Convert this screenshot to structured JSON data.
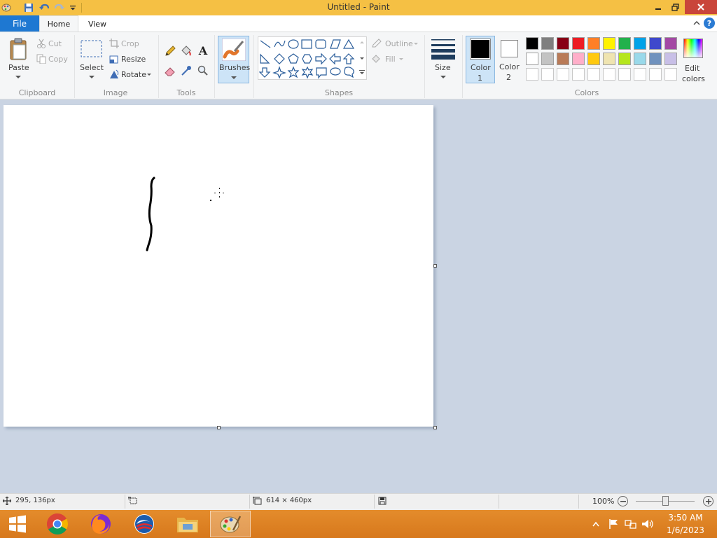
{
  "window": {
    "title": "Untitled - Paint"
  },
  "tabs": {
    "file": "File",
    "home": "Home",
    "view": "View"
  },
  "clipboard": {
    "paste": "Paste",
    "cut": "Cut",
    "copy": "Copy",
    "group": "Clipboard"
  },
  "image": {
    "select": "Select",
    "crop": "Crop",
    "resize": "Resize",
    "rotate": "Rotate",
    "group": "Image"
  },
  "tools": {
    "group": "Tools"
  },
  "brushes": {
    "label": "Brushes"
  },
  "shapes": {
    "outline": "Outline",
    "fill": "Fill",
    "group": "Shapes"
  },
  "size": {
    "label": "Size"
  },
  "colors": {
    "color1_label": "Color",
    "color1_num": "1",
    "color2_label": "Color",
    "color2_num": "2",
    "edit_label": "Edit",
    "edit_label2": "colors",
    "group": "Colors",
    "color1": "#000000",
    "color2": "#ffffff",
    "palette_row1": [
      "#000000",
      "#7f7f7f",
      "#880015",
      "#ed1c24",
      "#ff7f27",
      "#fff200",
      "#22b14c",
      "#00a2e8",
      "#3f48cc",
      "#a349a4"
    ],
    "palette_row2": [
      "#ffffff",
      "#c3c3c3",
      "#b97a57",
      "#ffaec9",
      "#ffc90e",
      "#efe4b0",
      "#b5e61d",
      "#99d9ea",
      "#7092be",
      "#c8bfe7"
    ]
  },
  "status": {
    "cursor_pos": "295, 136px",
    "canvas_size": "614 × 460px",
    "zoom": "100%"
  },
  "taskbar": {
    "time": "3:50 AM",
    "date": "1/6/2023"
  }
}
